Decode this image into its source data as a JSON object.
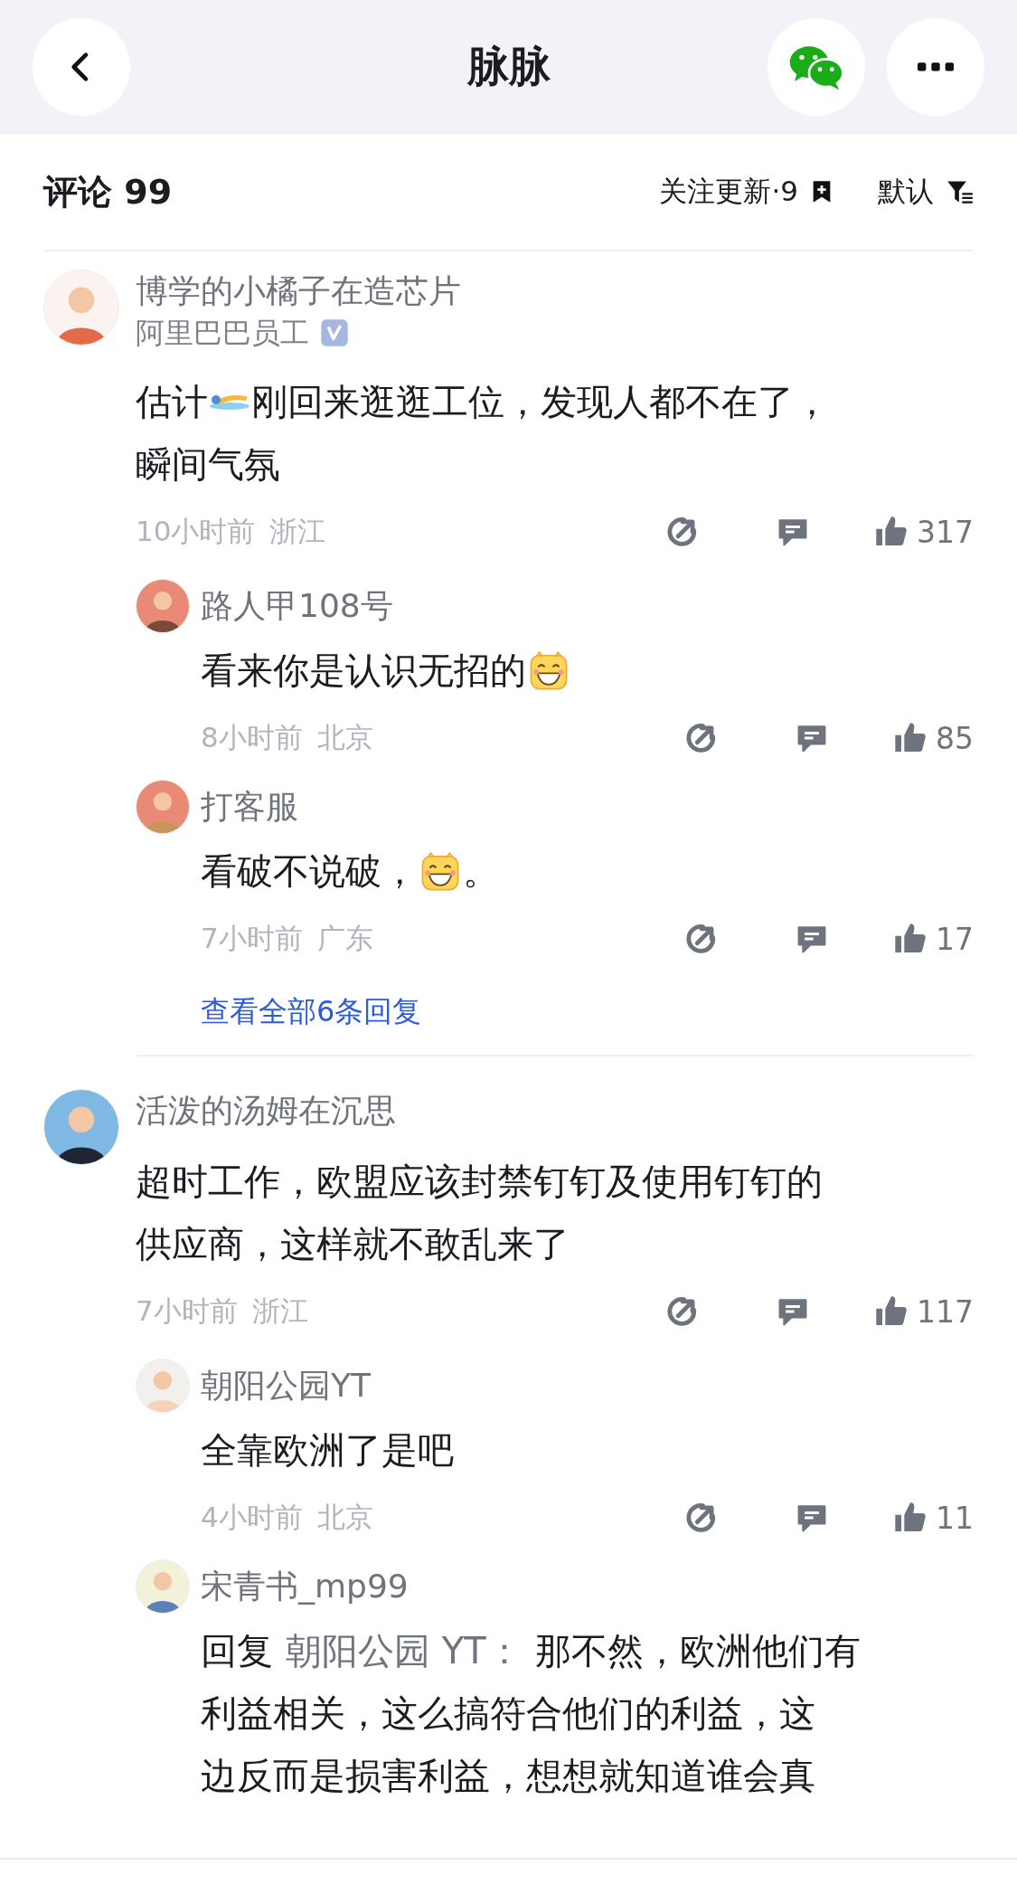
{
  "header": {
    "title": "脉脉"
  },
  "comments_bar": {
    "title": "评论 99",
    "follow_updates": "关注更新·9",
    "sort": "默认"
  },
  "threads": [
    {
      "author": "博学的小橘子在造芯片",
      "badge_text": "阿里巴巴员工",
      "verified": true,
      "body": [
        [
          {
            "kind": "text",
            "text": "估计"
          },
          {
            "kind": "swimmer"
          },
          {
            "kind": "text",
            "text": "刚回来逛逛工位，发现人都不在了，"
          }
        ],
        [
          {
            "kind": "text",
            "text": "瞬间气氛"
          }
        ]
      ],
      "time": "10小时前",
      "region": "浙江",
      "likes": "317",
      "replies": [
        {
          "author": "路人甲108号",
          "body": [
            [
              {
                "kind": "text",
                "text": "看来你是认识无招的"
              },
              {
                "kind": "grin"
              }
            ]
          ],
          "time": "8小时前",
          "region": "北京",
          "likes": "85"
        },
        {
          "author": "打客服",
          "body": [
            [
              {
                "kind": "text",
                "text": "看破不说破，"
              },
              {
                "kind": "grin"
              },
              {
                "kind": "text",
                "text": "。"
              }
            ]
          ],
          "time": "7小时前",
          "region": "广东",
          "likes": "17"
        }
      ],
      "more_replies": "查看全部6条回复"
    },
    {
      "author": "活泼的汤姆在沉思",
      "body": [
        [
          {
            "kind": "text",
            "text": "超时工作，欧盟应该封禁钉钉及使用钉钉的"
          }
        ],
        [
          {
            "kind": "text",
            "text": "供应商，这样就不敢乱来了"
          }
        ]
      ],
      "time": "7小时前",
      "region": "浙江",
      "likes": "117",
      "replies": [
        {
          "author": "朝阳公园YT",
          "body": [
            [
              {
                "kind": "text",
                "text": "全靠欧洲了是吧"
              }
            ]
          ],
          "time": "4小时前",
          "region": "北京",
          "likes": "11"
        },
        {
          "author": "宋青书_mp99",
          "body": [
            [
              {
                "kind": "text",
                "text": "回复"
              },
              {
                "kind": "mention",
                "text": "朝阳公园 YT："
              },
              {
                "kind": "text",
                "text": "那不然，欧洲他们有"
              }
            ],
            [
              {
                "kind": "text",
                "text": "利益相关，这么搞符合他们的利益，这"
              }
            ],
            [
              {
                "kind": "text",
                "text": "边反而是损害利益，想想就知道谁会真"
              }
            ]
          ]
        }
      ]
    }
  ]
}
